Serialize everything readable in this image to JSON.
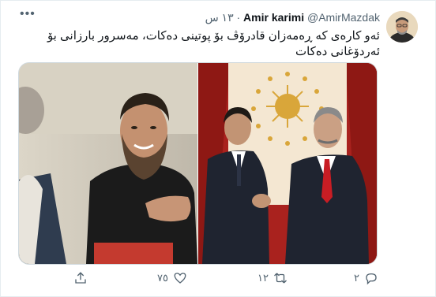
{
  "tweet": {
    "author_name": "Amir karimi",
    "author_handle": "@AmirMazdak",
    "separator": "·",
    "time": "١٣ س",
    "text": "ئەو کارەی کە ڕەمەزان قادرۆڤ بۆ پوتینی دەکات، مەسرور بارزانی بۆ ئەردۆغانی دەکات"
  },
  "actions": {
    "reply_count": "٢",
    "retweet_count": "١٢",
    "like_count": "٧٥",
    "share_label": ""
  },
  "icons": {
    "more": "more-icon",
    "reply": "reply-icon",
    "retweet": "retweet-icon",
    "like": "heart-icon",
    "share": "share-icon"
  },
  "colors": {
    "text": "#0f1419",
    "muted": "#536471",
    "border": "#cfd9de"
  }
}
